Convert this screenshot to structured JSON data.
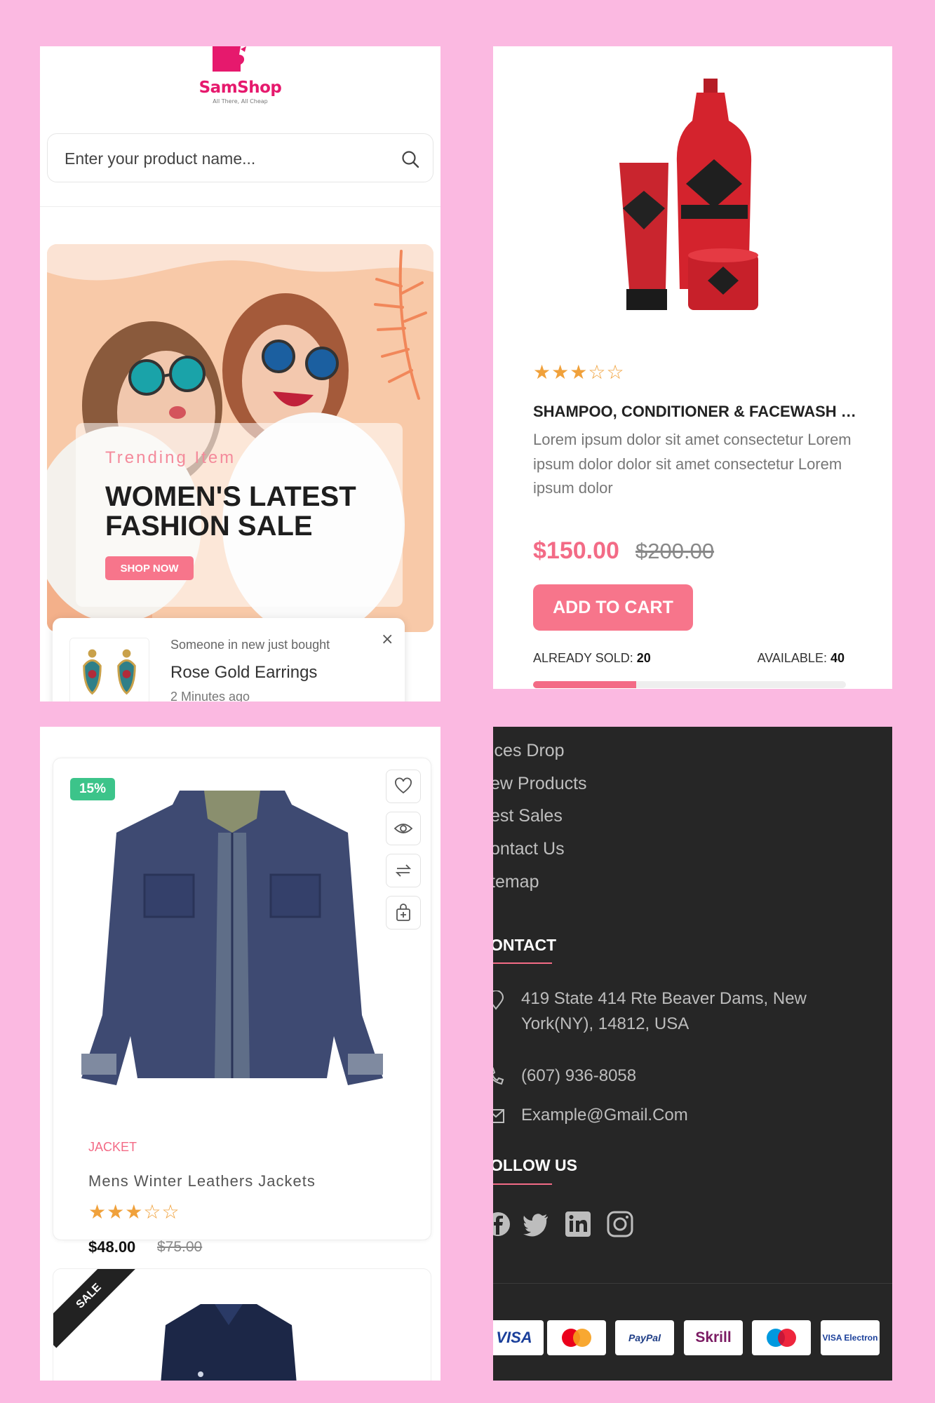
{
  "panel1": {
    "logo": {
      "brand_a": "Sam",
      "brand_b": "Shop",
      "tagline": "All There, All Cheap"
    },
    "search": {
      "placeholder": "Enter your product name..."
    },
    "hero": {
      "kicker": "Trending Item",
      "title": "WOMEN'S LATEST FASHION SALE",
      "button": "SHOP NOW"
    },
    "toast": {
      "subtitle": "Someone in new just bought",
      "product": "Rose Gold Earrings",
      "time": "2 Minutes ago",
      "close": "×"
    }
  },
  "panel2": {
    "rating": 3,
    "title": "SHAMPOO, CONDITIONER & FACEWASH PACKS",
    "description": "Lorem ipsum dolor sit amet consectetur Lorem ipsum dolor dolor sit amet consectetur Lorem ipsum dolor",
    "price": "$150.00",
    "old_price": "$200.00",
    "add_to_cart": "ADD TO CART",
    "sold_label": "ALREADY SOLD:",
    "sold_value": "20",
    "available_label": "AVAILABLE:",
    "available_value": "40",
    "sold_fraction": 0.33
  },
  "panel3": {
    "badge": "15%",
    "category": "JACKET",
    "name": "Mens Winter Leathers Jackets",
    "rating": 3,
    "price": "$48.00",
    "old_price": "$75.00",
    "ribbon": "SALE",
    "actions": [
      "heart-icon",
      "eye-icon",
      "repeat-icon",
      "bag-add-icon"
    ]
  },
  "panel4": {
    "links": [
      "ices Drop",
      "ew Products",
      "est Sales",
      "ontact Us",
      "temap"
    ],
    "contact_heading": "ONTACT",
    "address": "419 State 414 Rte Beaver Dams, New York(NY), 14812, USA",
    "phone": "(607) 936-8058",
    "email": "Example@Gmail.Com",
    "follow_heading": "OLLOW US",
    "payments": [
      "VISA",
      "MasterCard",
      "PayPal",
      "Skrill",
      "Maestro",
      "VISA Electron"
    ]
  },
  "colors": {
    "background": "#fbb9e1",
    "accent": "#f7758b",
    "brand": "#e6196d",
    "badge_green": "#3cc48a",
    "footer": "#262626"
  }
}
